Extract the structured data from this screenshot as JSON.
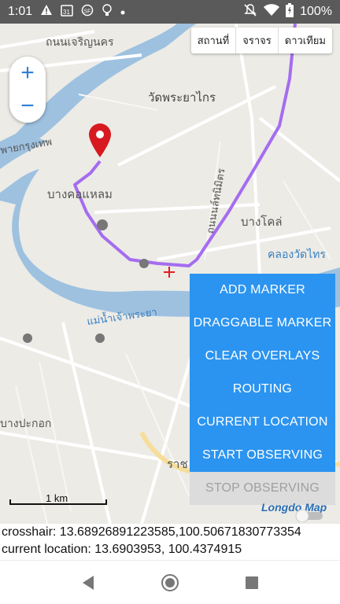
{
  "status_bar": {
    "time": "1:01",
    "battery": "100%"
  },
  "map": {
    "layer_buttons": [
      "สถานที่",
      "จราจร",
      "ดาวเทียม"
    ],
    "zoom_in": "+",
    "zoom_out": "−",
    "labels": {
      "bangkok_road": "ถนนเจริญนคร",
      "wat": "วัดพระยาไกร",
      "bang_kho_laem": "บางคอแหลม",
      "bang_khlo": "บางโคล่",
      "khlong_wat_thai": "คลองวัดไทร",
      "chao_phraya": "แม่น้ำเจ้าพระยา",
      "bang_pakok": "บางปะกอก",
      "charoen_krung": "พายกรุงเทพ",
      "rama": "ราช",
      "nanglinchi": "ถนนนล์ทนิมิตร"
    },
    "scale_label": "1 km",
    "logo": "Longdo Map"
  },
  "menu": {
    "items": [
      "ADD MARKER",
      "DRAGGABLE MARKER",
      "CLEAR OVERLAYS",
      "ROUTING",
      "CURRENT LOCATION",
      "START OBSERVING"
    ],
    "disabled_item": "STOP OBSERVING"
  },
  "info": {
    "crosshair": "crosshair: 13.68926891223585,100.50671830773354",
    "current_location": "current location: 13.6903953, 100.4374915"
  },
  "colors": {
    "route": "#a56cf0",
    "river": "#9ec1e0",
    "button": "#2b94f0",
    "marker": "#d71920"
  },
  "icons": [
    "alert-icon",
    "calendar-icon",
    "settings-icon",
    "bulb-icon",
    "dot-icon",
    "mute-icon",
    "wifi-icon",
    "battery-icon",
    "back-icon",
    "home-icon",
    "recents-icon",
    "map-pin-icon",
    "crosshair-icon"
  ]
}
